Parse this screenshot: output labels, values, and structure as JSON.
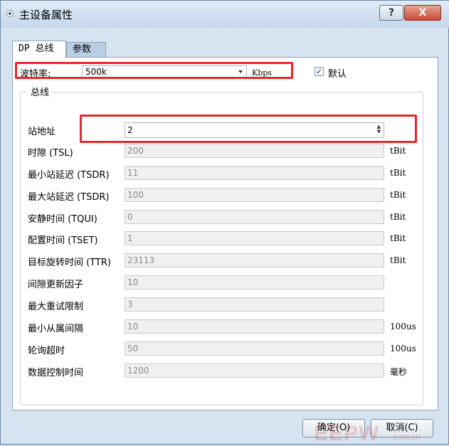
{
  "window": {
    "title": "主设备属性",
    "help_label": "?",
    "close_label": "X"
  },
  "tabs": [
    {
      "label": "DP 总线",
      "active": true
    },
    {
      "label": "参数",
      "active": false
    }
  ],
  "baud": {
    "label": "波特率:",
    "value": "500k",
    "unit": "Kbps"
  },
  "default_checkbox": {
    "label": "默认",
    "checked": true,
    "check_glyph": "✓"
  },
  "group": {
    "title": "总线",
    "rows": [
      {
        "label": "站地址",
        "value": "2",
        "unit": "",
        "editable": true
      },
      {
        "label": "时隙 (TSL)",
        "value": "200",
        "unit": "tBit",
        "editable": false
      },
      {
        "label": "最小站延迟 (TSDR)",
        "value": "11",
        "unit": "tBit",
        "editable": false
      },
      {
        "label": "最大站延迟 (TSDR)",
        "value": "100",
        "unit": "tBit",
        "editable": false
      },
      {
        "label": "安静时间 (TQUI)",
        "value": "0",
        "unit": "tBit",
        "editable": false
      },
      {
        "label": "配置时间 (TSET)",
        "value": "1",
        "unit": "tBit",
        "editable": false
      },
      {
        "label": "目标旋转时间 (TTR)",
        "value": "23113",
        "unit": "tBit",
        "editable": false
      },
      {
        "label": "间隙更新因子",
        "value": "10",
        "unit": "",
        "editable": false
      },
      {
        "label": "最大重试限制",
        "value": "3",
        "unit": "",
        "editable": false
      },
      {
        "label": "最小从属间隔",
        "value": "10",
        "unit": "100us",
        "editable": false
      },
      {
        "label": "轮询超时",
        "value": "50",
        "unit": "100us",
        "editable": false
      },
      {
        "label": "数据控制时间",
        "value": "1200",
        "unit": "毫秒",
        "editable": false
      }
    ]
  },
  "buttons": {
    "ok": "确定(O)",
    "cancel": "取消(C)"
  },
  "watermark": {
    "text": "EEPW",
    "sub": ".com.cn"
  },
  "colors": {
    "highlight": "#e8262c",
    "window_bg": "#d6e4f2",
    "disabled_field": "#f0f0f0"
  }
}
